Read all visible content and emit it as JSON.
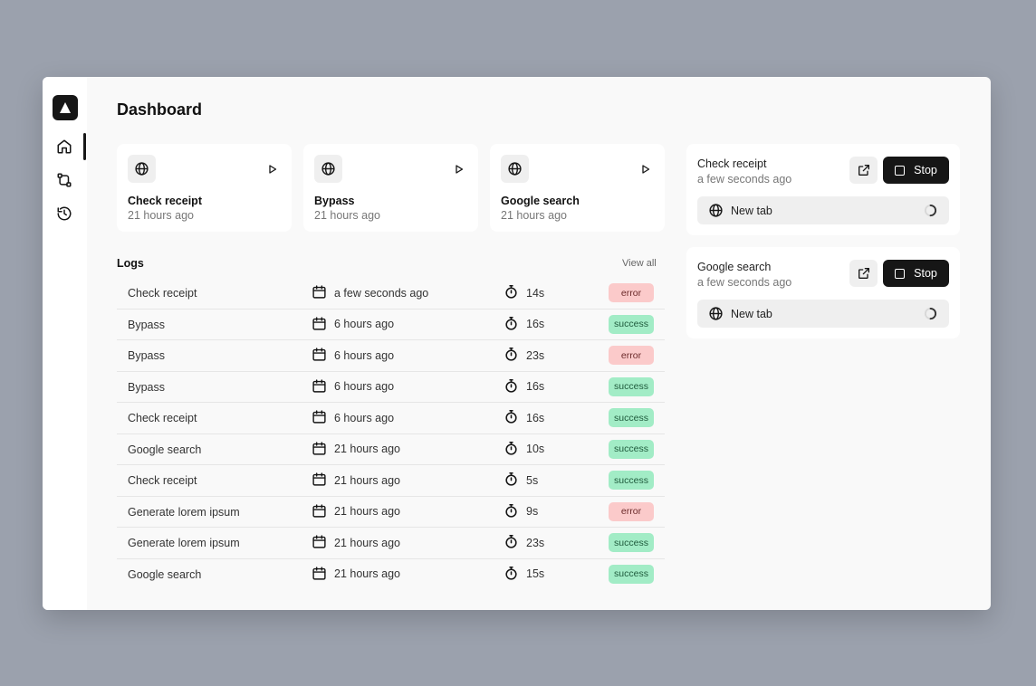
{
  "page": {
    "title": "Dashboard"
  },
  "sidebar": {
    "items": [
      {
        "icon": "home-icon",
        "active": true
      },
      {
        "icon": "workflow-icon",
        "active": false
      },
      {
        "icon": "history-icon",
        "active": false
      }
    ]
  },
  "cards": [
    {
      "title": "Check receipt",
      "time": "21 hours ago"
    },
    {
      "title": "Bypass",
      "time": "21 hours ago"
    },
    {
      "title": "Google search",
      "time": "21 hours ago"
    }
  ],
  "logs": {
    "title": "Logs",
    "view_all": "View all",
    "rows": [
      {
        "name": "Check receipt",
        "date": "a few seconds ago",
        "duration": "14s",
        "status": "error"
      },
      {
        "name": "Bypass",
        "date": "6 hours ago",
        "duration": "16s",
        "status": "success"
      },
      {
        "name": "Bypass",
        "date": "6 hours ago",
        "duration": "23s",
        "status": "error"
      },
      {
        "name": "Bypass",
        "date": "6 hours ago",
        "duration": "16s",
        "status": "success"
      },
      {
        "name": "Check receipt",
        "date": "6 hours ago",
        "duration": "16s",
        "status": "success"
      },
      {
        "name": "Google search",
        "date": "21 hours ago",
        "duration": "10s",
        "status": "success"
      },
      {
        "name": "Check receipt",
        "date": "21 hours ago",
        "duration": "5s",
        "status": "success"
      },
      {
        "name": "Generate lorem ipsum",
        "date": "21 hours ago",
        "duration": "9s",
        "status": "error"
      },
      {
        "name": "Generate lorem ipsum",
        "date": "21 hours ago",
        "duration": "23s",
        "status": "success"
      },
      {
        "name": "Google search",
        "date": "21 hours ago",
        "duration": "15s",
        "status": "success"
      }
    ]
  },
  "running": [
    {
      "title": "Check receipt",
      "time": "a few seconds ago",
      "stop_label": "Stop",
      "tab_label": "New tab"
    },
    {
      "title": "Google search",
      "time": "a few seconds ago",
      "stop_label": "Stop",
      "tab_label": "New tab"
    }
  ],
  "colors": {
    "error_bg": "#fbcaca",
    "success_bg": "#a2ecc6",
    "primary": "#161616"
  }
}
